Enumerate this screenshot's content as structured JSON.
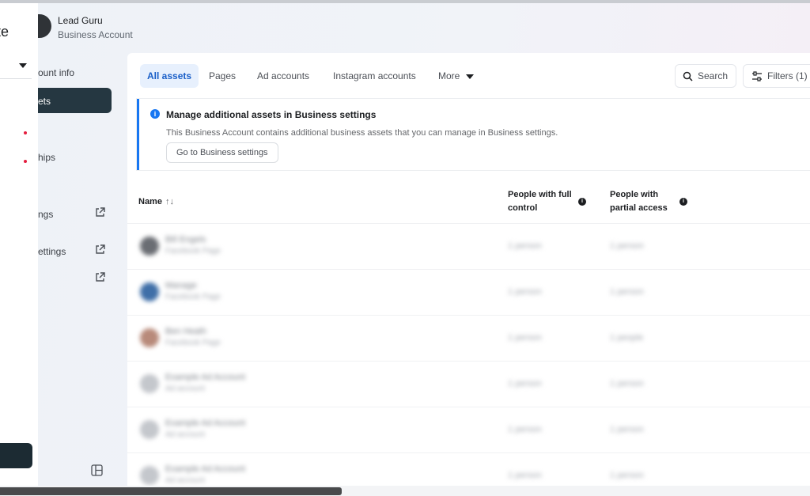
{
  "account": {
    "name": "Lead Guru",
    "type": "Business Account"
  },
  "sidebar": {
    "app_name_fragment": "te",
    "items": [
      {
        "label": "ount info"
      },
      {
        "label": "ets"
      },
      {
        "label": "hips"
      },
      {
        "label": "ngs"
      },
      {
        "label": "ettings"
      }
    ]
  },
  "tabs": [
    {
      "label": "All assets",
      "active": true
    },
    {
      "label": "Pages"
    },
    {
      "label": "Ad accounts"
    },
    {
      "label": "Instagram accounts"
    },
    {
      "label": "More"
    }
  ],
  "toolbar": {
    "search_label": "Search",
    "filters_label": "Filters (1)"
  },
  "banner": {
    "title": "Manage additional assets in Business settings",
    "description": "This Business Account contains additional business assets that you can manage in Business settings.",
    "button_label": "Go to Business settings"
  },
  "table": {
    "headers": {
      "name": "Name",
      "full_control": "People with full control",
      "partial_access": "People with partial access"
    },
    "rows": [
      {
        "name": "Bill Engels",
        "type": "Facebook Page",
        "full": "1 person",
        "partial": "1 person",
        "thumb_color": "#6a6d73"
      },
      {
        "name": "Manage",
        "type": "Facebook Page",
        "full": "1 person",
        "partial": "1 person",
        "thumb_color": "#3f6fa8"
      },
      {
        "name": "Ben Heath",
        "type": "Facebook Page",
        "full": "1 person",
        "partial": "1 people",
        "thumb_color": "#b88a7a"
      },
      {
        "name": "Example Ad Account",
        "type": "Ad account",
        "full": "1 person",
        "partial": "1 person",
        "thumb_color": "#c4c7cc"
      },
      {
        "name": "Example Ad Account",
        "type": "Ad account",
        "full": "1 person",
        "partial": "1 person",
        "thumb_color": "#c4c7cc"
      },
      {
        "name": "Example Ad Account",
        "type": "Ad account",
        "full": "1 person",
        "partial": "1 person",
        "thumb_color": "#c4c7cc"
      }
    ]
  },
  "colors": {
    "accent": "#1877f2",
    "active_tab_bg": "#e7f0fd",
    "sidebar_active": "#253741"
  }
}
